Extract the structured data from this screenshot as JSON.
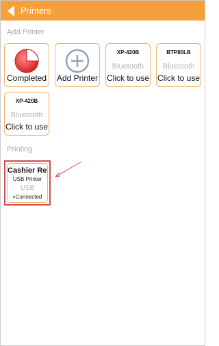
{
  "header": {
    "title": "Printers"
  },
  "sections": {
    "add_printer": "Add Printer",
    "printing": "Printing"
  },
  "tiles": {
    "completed": {
      "label": "Completed",
      "icon": "pie-chart-icon"
    },
    "add": {
      "label": "Add Printer",
      "icon": "plus-circle-icon"
    },
    "p1": {
      "model": "XP-420B",
      "connection": "Bluetooth",
      "action": "Click to use"
    },
    "p2": {
      "model": "BTP80LB",
      "connection": "Bluetooth",
      "action": "Click to use"
    },
    "p3": {
      "model": "XP-420B",
      "connection": "Bluetooth",
      "action": "Click to use"
    }
  },
  "printing": {
    "name": "Cashier Re...",
    "type": "USB Printer",
    "connection": "USB",
    "status": "Connected"
  },
  "colors": {
    "header": "#f5a03a",
    "tile_border": "#f3b46a",
    "highlight": "#d94a4a",
    "status_dot": "#2ea84a"
  }
}
